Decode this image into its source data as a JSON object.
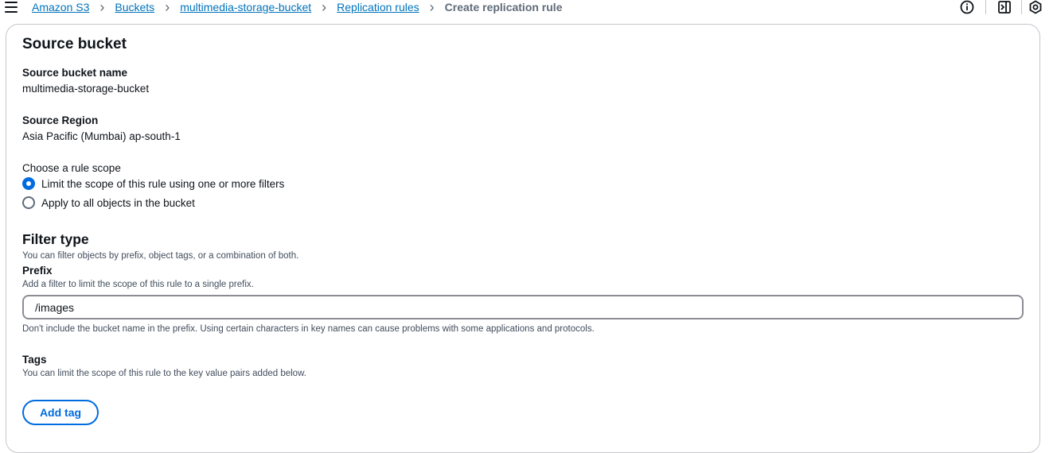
{
  "breadcrumb": {
    "items": [
      {
        "label": "Amazon S3"
      },
      {
        "label": "Buckets"
      },
      {
        "label": "multimedia-storage-bucket"
      },
      {
        "label": "Replication rules"
      }
    ],
    "current": "Create replication rule",
    "separator": "›"
  },
  "icons": {
    "menu": "hamburger-menu-icon",
    "info": "info-icon",
    "panel": "side-panel-icon",
    "settings": "gear-icon"
  },
  "source_bucket": {
    "heading": "Source bucket",
    "name_label": "Source bucket name",
    "name_value": "multimedia-storage-bucket",
    "region_label": "Source Region",
    "region_value": "Asia Pacific (Mumbai) ap-south-1",
    "scope_label": "Choose a rule scope",
    "scope_options": [
      {
        "label": "Limit the scope of this rule using one or more filters",
        "selected": true
      },
      {
        "label": "Apply to all objects in the bucket",
        "selected": false
      }
    ]
  },
  "filter_type": {
    "heading": "Filter type",
    "description": "You can filter objects by prefix, object tags, or a combination of both.",
    "prefix_label": "Prefix",
    "prefix_description": "Add a filter to limit the scope of this rule to a single prefix.",
    "prefix_value": "/images",
    "prefix_hint": "Don't include the bucket name in the prefix. Using certain characters in key names can cause problems with some applications and protocols.",
    "tags_label": "Tags",
    "tags_description": "You can limit the scope of this rule to the key value pairs added below.",
    "add_tag_label": "Add tag"
  },
  "colors": {
    "link": "#0073bb",
    "primary": "#006ce0",
    "text": "#0f141a",
    "muted": "#5f6b7a",
    "border": "#c6c6cd"
  }
}
